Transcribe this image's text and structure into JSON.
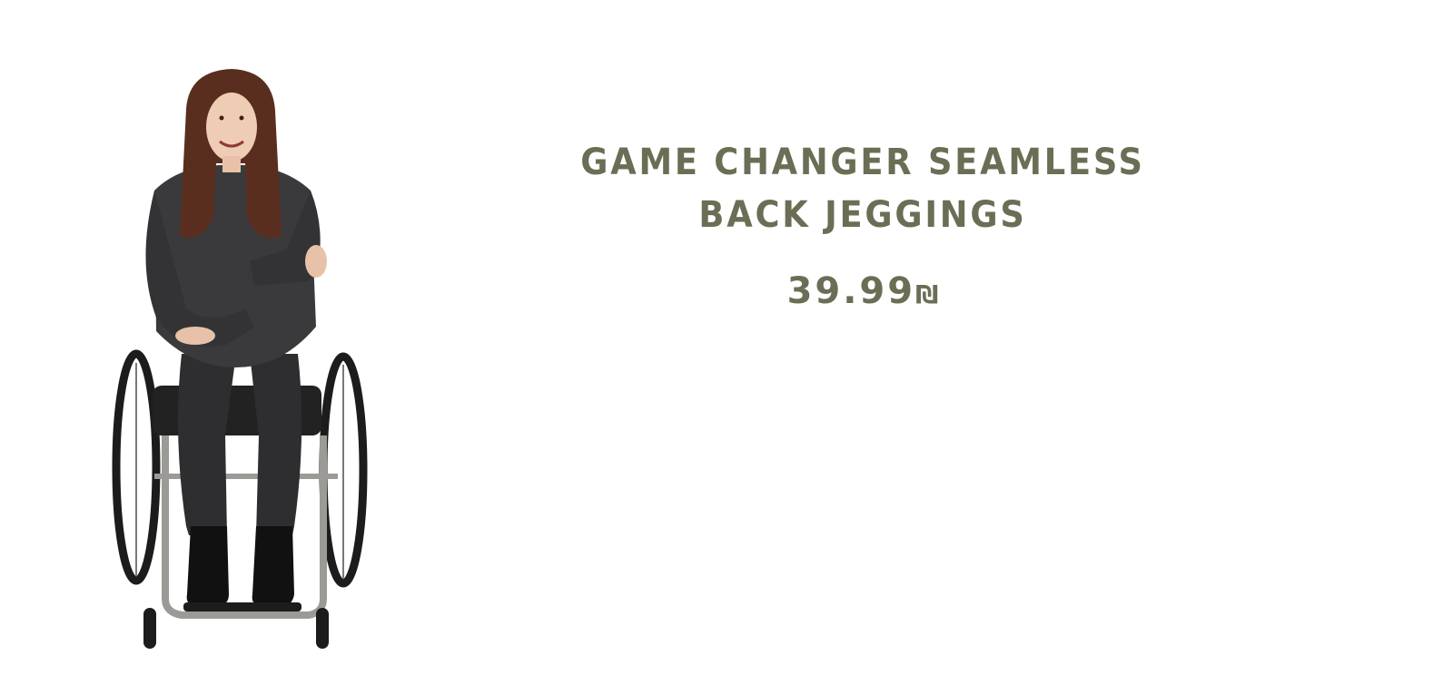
{
  "product": {
    "image_alt": "Woman in a dark sweatshirt and jeggings seated in a wheelchair",
    "title": "Game Changer Seamless Back Jeggings",
    "price": "39.99",
    "currency": "₪"
  },
  "colors": {
    "text": "#6b6e55",
    "background": "#ffffff"
  }
}
